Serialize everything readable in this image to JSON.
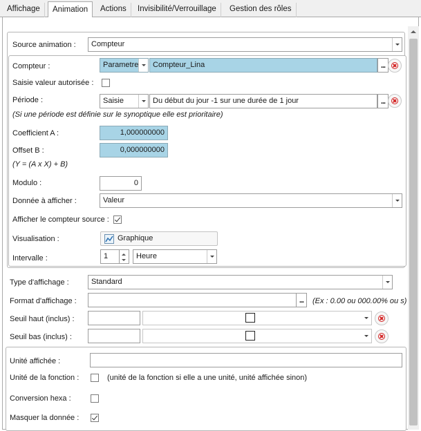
{
  "tabs": [
    "Affichage",
    "Animation",
    "Actions",
    "Invisibilité/Verrouillage",
    "Gestion des rôles"
  ],
  "source_animation": {
    "label": "Source animation :",
    "value": "Compteur"
  },
  "compteur": {
    "label": "Compteur :",
    "type": "Parametre",
    "value": "Compteur_Lina"
  },
  "saisie_valeur": {
    "label": "Saisie valeur autorisée :"
  },
  "periode": {
    "label": "Période :",
    "type": "Saisie",
    "value": "Du début du jour -1 sur une durée de 1 jour",
    "note": "(Si une période est définie sur le synoptique elle est prioritaire)"
  },
  "coef_a": {
    "label": "Coefficient A :",
    "value": "1,000000000"
  },
  "offset_b": {
    "label": "Offset B :",
    "value": "0,000000000",
    "formula": "(Y = (A x X) + B)"
  },
  "modulo": {
    "label": "Modulo :",
    "value": "0"
  },
  "donnee": {
    "label": "Donnée à afficher :",
    "value": "Valeur"
  },
  "afficher_compteur": {
    "label": "Afficher le compteur source :",
    "checked": true
  },
  "visualisation": {
    "label": "Visualisation :",
    "button": "Graphique"
  },
  "intervalle": {
    "label": "Intervalle :",
    "value": "1",
    "unit": "Heure"
  },
  "type_affichage": {
    "label": "Type d'affichage :",
    "value": "Standard"
  },
  "format_affichage": {
    "label": "Format d'affichage :",
    "value": "",
    "hint": "(Ex : 0.00 ou 000.00% ou s)"
  },
  "seuil_haut": {
    "label": "Seuil haut (inclus) :",
    "value": ""
  },
  "seuil_bas": {
    "label": "Seuil bas (inclus) :",
    "value": ""
  },
  "unite_affichee": {
    "label": "Unité affichée :",
    "value": ""
  },
  "unite_fonction": {
    "label": "Unité de la fonction :",
    "note": "(unité de la fonction si elle a une unité, unité affichée sinon)",
    "checked": false
  },
  "conversion_hexa": {
    "label": "Conversion hexa :",
    "checked": false
  },
  "masquer_donnee": {
    "label": "Masquer la donnée :",
    "checked": true
  },
  "dots": "...",
  "colors": {
    "field_blue": "#a8d4e6",
    "close_red": "#d42222"
  }
}
